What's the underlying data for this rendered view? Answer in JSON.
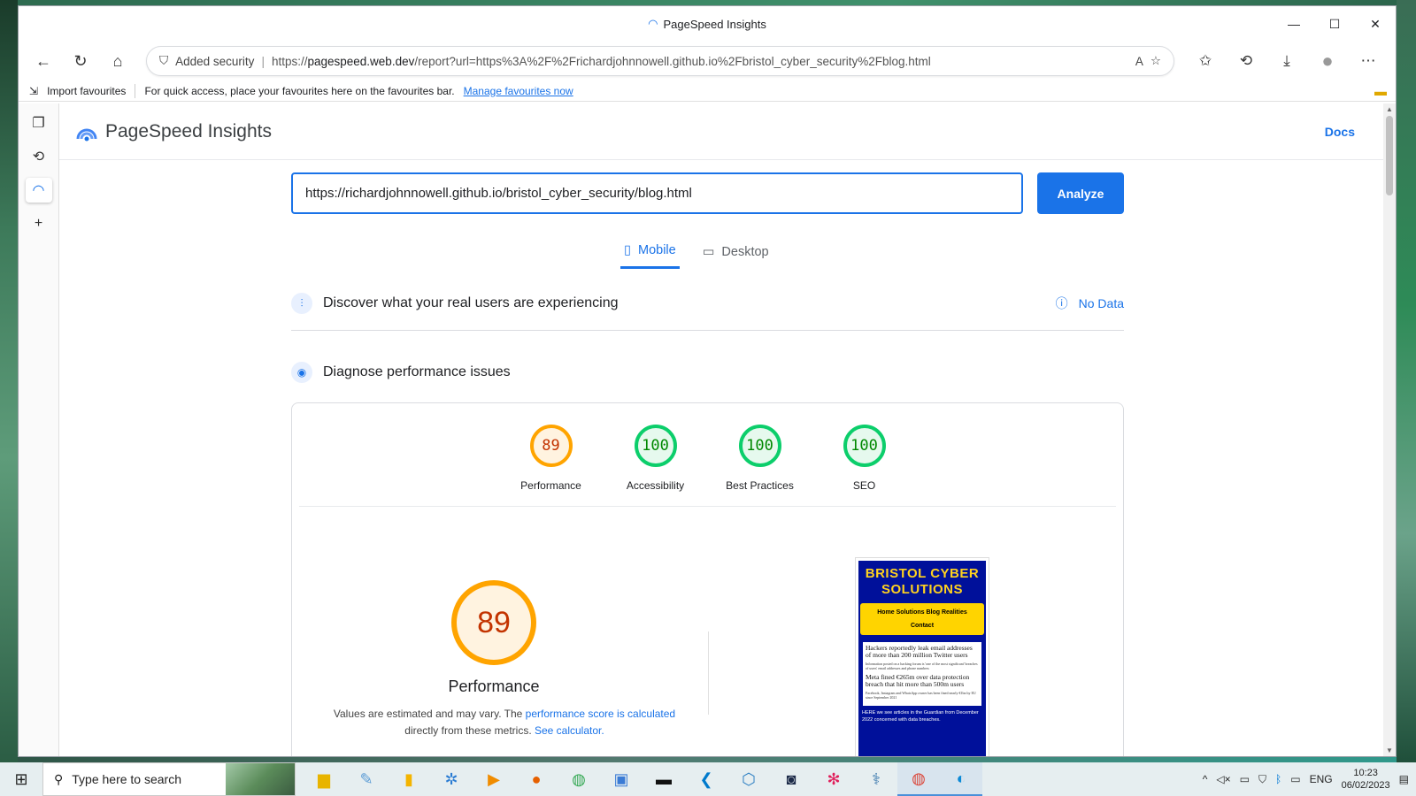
{
  "window": {
    "title": "PageSpeed Insights"
  },
  "browser": {
    "security_label": "Added security",
    "url_prefix": "https://",
    "url_host": "pagespeed.web.dev",
    "url_path": "/report?url=https%3A%2F%2Frichardjohnnowell.github.io%2Fbristol_cyber_security%2Fblog.html",
    "favbar": {
      "import": "Import favourites",
      "hint": "For quick access, place your favourites here on the favourites bar.",
      "manage": "Manage favourites now"
    }
  },
  "psi": {
    "brand": "PageSpeed Insights",
    "docs": "Docs",
    "url_value": "https://richardjohnnowell.github.io/bristol_cyber_security/blog.html",
    "analyze": "Analyze",
    "tabs": [
      {
        "label": "Mobile",
        "active": true
      },
      {
        "label": "Desktop",
        "active": false
      }
    ],
    "real_users": {
      "title": "Discover what your real users are experiencing",
      "status": "No Data"
    },
    "diagnose": {
      "title": "Diagnose performance issues"
    },
    "scores": [
      {
        "label": "Performance",
        "value": "89",
        "color": "#ffa400"
      },
      {
        "label": "Accessibility",
        "value": "100",
        "color": "#0cce6b"
      },
      {
        "label": "Best Practices",
        "value": "100",
        "color": "#0cce6b"
      },
      {
        "label": "SEO",
        "value": "100",
        "color": "#0cce6b"
      }
    ],
    "main_score": {
      "value": "89",
      "label": "Performance"
    },
    "note": {
      "pre": "Values are estimated and may vary. The ",
      "link1": "performance score is calculated",
      "mid": " directly from these metrics. ",
      "link2": "See calculator."
    },
    "preview": {
      "title": "BRISTOL CYBER SOLUTIONS",
      "nav": "Home  Solutions  Blog  Realities",
      "nav2": "Contact",
      "h1": "Hackers reportedly leak email addresses of more than 200 million Twitter users",
      "s1": "Information posted on a hacking forum is 'one of the most significant' breaches of users' email addresses and phone numbers",
      "h2": "Meta fined €265m over data protection breach that hit more than 500m users",
      "s2": "Facebook, Instagram and WhatsApp owner has been fined nearly €1bn by EU since September 2021",
      "foot": "HERE we see articles in the Guardian from December 2022 concerned with data breaches."
    }
  },
  "taskbar": {
    "search_placeholder": "Type here to search",
    "lang": "ENG",
    "time": "10:23",
    "date": "06/02/2023"
  }
}
